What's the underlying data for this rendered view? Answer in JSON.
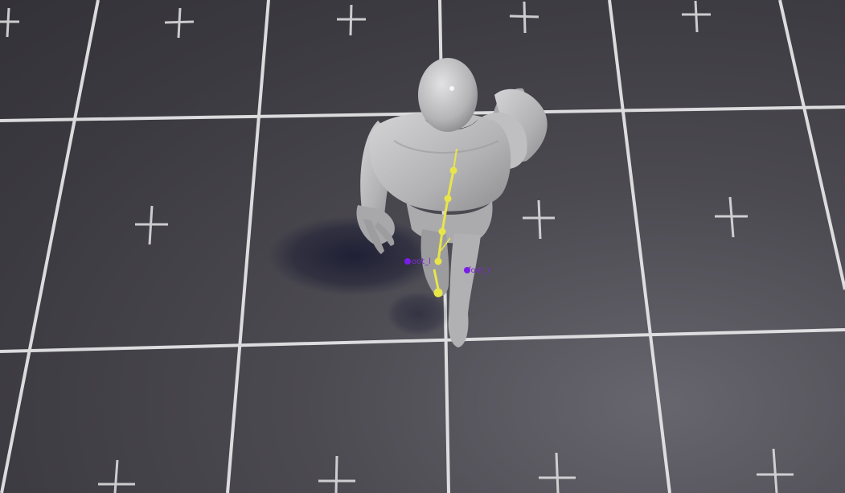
{
  "viewport": {
    "floor_color": "#3c3b40",
    "grid_line_color": "#e8e8ea",
    "marker_color": "#d8d8da",
    "mannequin_color": "#b9b9bb",
    "bone_color": "#e7e44c",
    "bone_label_color": "#7b2bd3"
  },
  "bones": {
    "left_foot_label": "oot_l",
    "right_foot_label": "foot_r"
  }
}
